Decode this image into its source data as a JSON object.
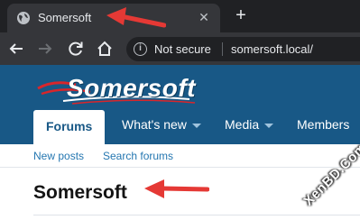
{
  "browser": {
    "tab": {
      "title": "Somersoft",
      "close_glyph": "✕",
      "favicon": "globe-icon"
    },
    "new_tab_glyph": "+",
    "toolbar": {
      "back": "arrow-back-icon",
      "forward": "arrow-forward-icon",
      "reload": "reload-icon",
      "home": "home-icon"
    },
    "omnibox": {
      "security_label": "Not secure",
      "info_glyph": "i",
      "url": "somersoft.local/"
    }
  },
  "site": {
    "logo_text": "Somersoft",
    "nav": {
      "tabs": [
        {
          "label": "Forums",
          "active": true,
          "dropdown": false
        },
        {
          "label": "What's new",
          "active": false,
          "dropdown": true
        },
        {
          "label": "Media",
          "active": false,
          "dropdown": true
        },
        {
          "label": "Members",
          "active": false,
          "dropdown": false
        }
      ]
    },
    "subnav": {
      "links": [
        {
          "label": "New posts"
        },
        {
          "label": "Search forums"
        }
      ]
    },
    "page_title": "Somersoft"
  },
  "annotations": {
    "arrow_color": "#e53935"
  },
  "watermark": "XenBD.Com",
  "colors": {
    "brand_blue": "#185886",
    "link_blue": "#2577b1",
    "chrome_dark": "#202124",
    "chrome_tab": "#35363a"
  }
}
